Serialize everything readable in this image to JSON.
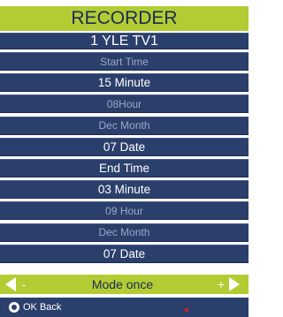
{
  "header": {
    "title": "RECORDER"
  },
  "channel": "1 YLE TV1",
  "rows": [
    {
      "label": "Start Time"
    },
    {
      "label": "15 Minute"
    },
    {
      "label": "08Hour"
    },
    {
      "label": "Dec Month"
    },
    {
      "label": "07 Date"
    },
    {
      "label": "End Time"
    },
    {
      "label": "03 Minute"
    },
    {
      "label": "09 Hour"
    },
    {
      "label": "Dec Month"
    },
    {
      "label": "07 Date"
    }
  ],
  "mode": {
    "label": "Mode once",
    "minus": "-",
    "plus": "+"
  },
  "footer": {
    "label": "OK Back"
  },
  "colors": {
    "accent": "#b3cc33",
    "panel": "#2b3f6c",
    "text_dark": "#1b2a5a"
  }
}
